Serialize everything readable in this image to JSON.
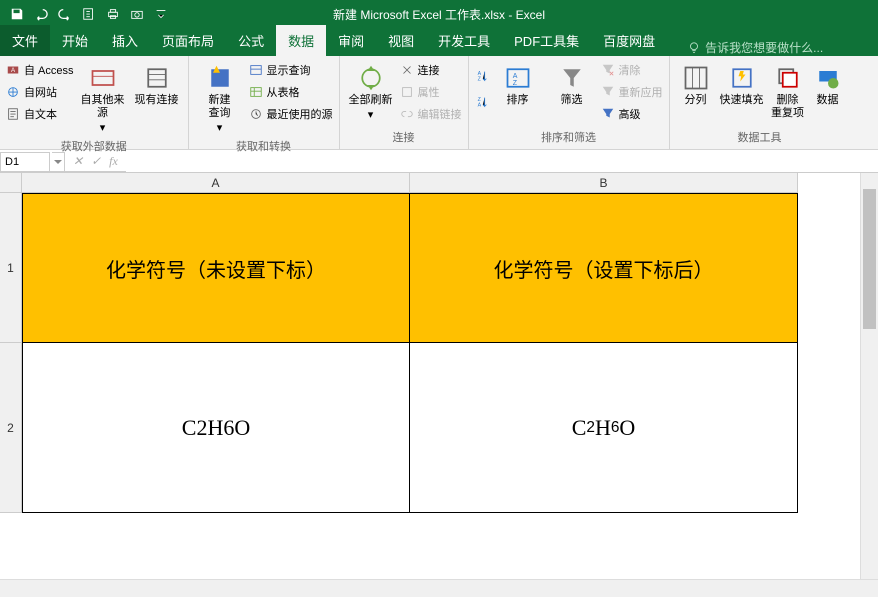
{
  "title": "新建 Microsoft Excel 工作表.xlsx - Excel",
  "tabs": [
    "文件",
    "开始",
    "插入",
    "页面布局",
    "公式",
    "数据",
    "审阅",
    "视图",
    "开发工具",
    "PDF工具集",
    "百度网盘"
  ],
  "activeTab": "数据",
  "tellMe": "告诉我您想要做什么...",
  "ribbon": {
    "g1": {
      "title": "获取外部数据",
      "access": "自 Access",
      "web": "自网站",
      "text": "自文本",
      "other": "自其他来源",
      "conn": "现有连接"
    },
    "g2": {
      "title": "获取和转换",
      "new": "新建\n查询",
      "show": "显示查询",
      "table": "从表格",
      "recent": "最近使用的源"
    },
    "g3": {
      "title": "连接",
      "refresh": "全部刷新",
      "conn": "连接",
      "prop": "属性",
      "edit": "编辑链接"
    },
    "g4": {
      "title": "排序和筛选",
      "sort": "排序",
      "filter": "筛选",
      "clear": "清除",
      "reapply": "重新应用",
      "adv": "高级"
    },
    "g5": {
      "title": "数据工具",
      "split": "分列",
      "flash": "快速填充",
      "dup": "删除\n重复项",
      "val": "数据"
    }
  },
  "namebox": "D1",
  "columns": [
    "A",
    "B"
  ],
  "rows": [
    "1",
    "2"
  ],
  "cells": {
    "A1": "化学符号（未设置下标）",
    "B1": "化学符号（设置下标后）",
    "A2_plain": "C2H6O",
    "B2_html": "C<sub>2</sub>H<sub>6</sub>O"
  }
}
